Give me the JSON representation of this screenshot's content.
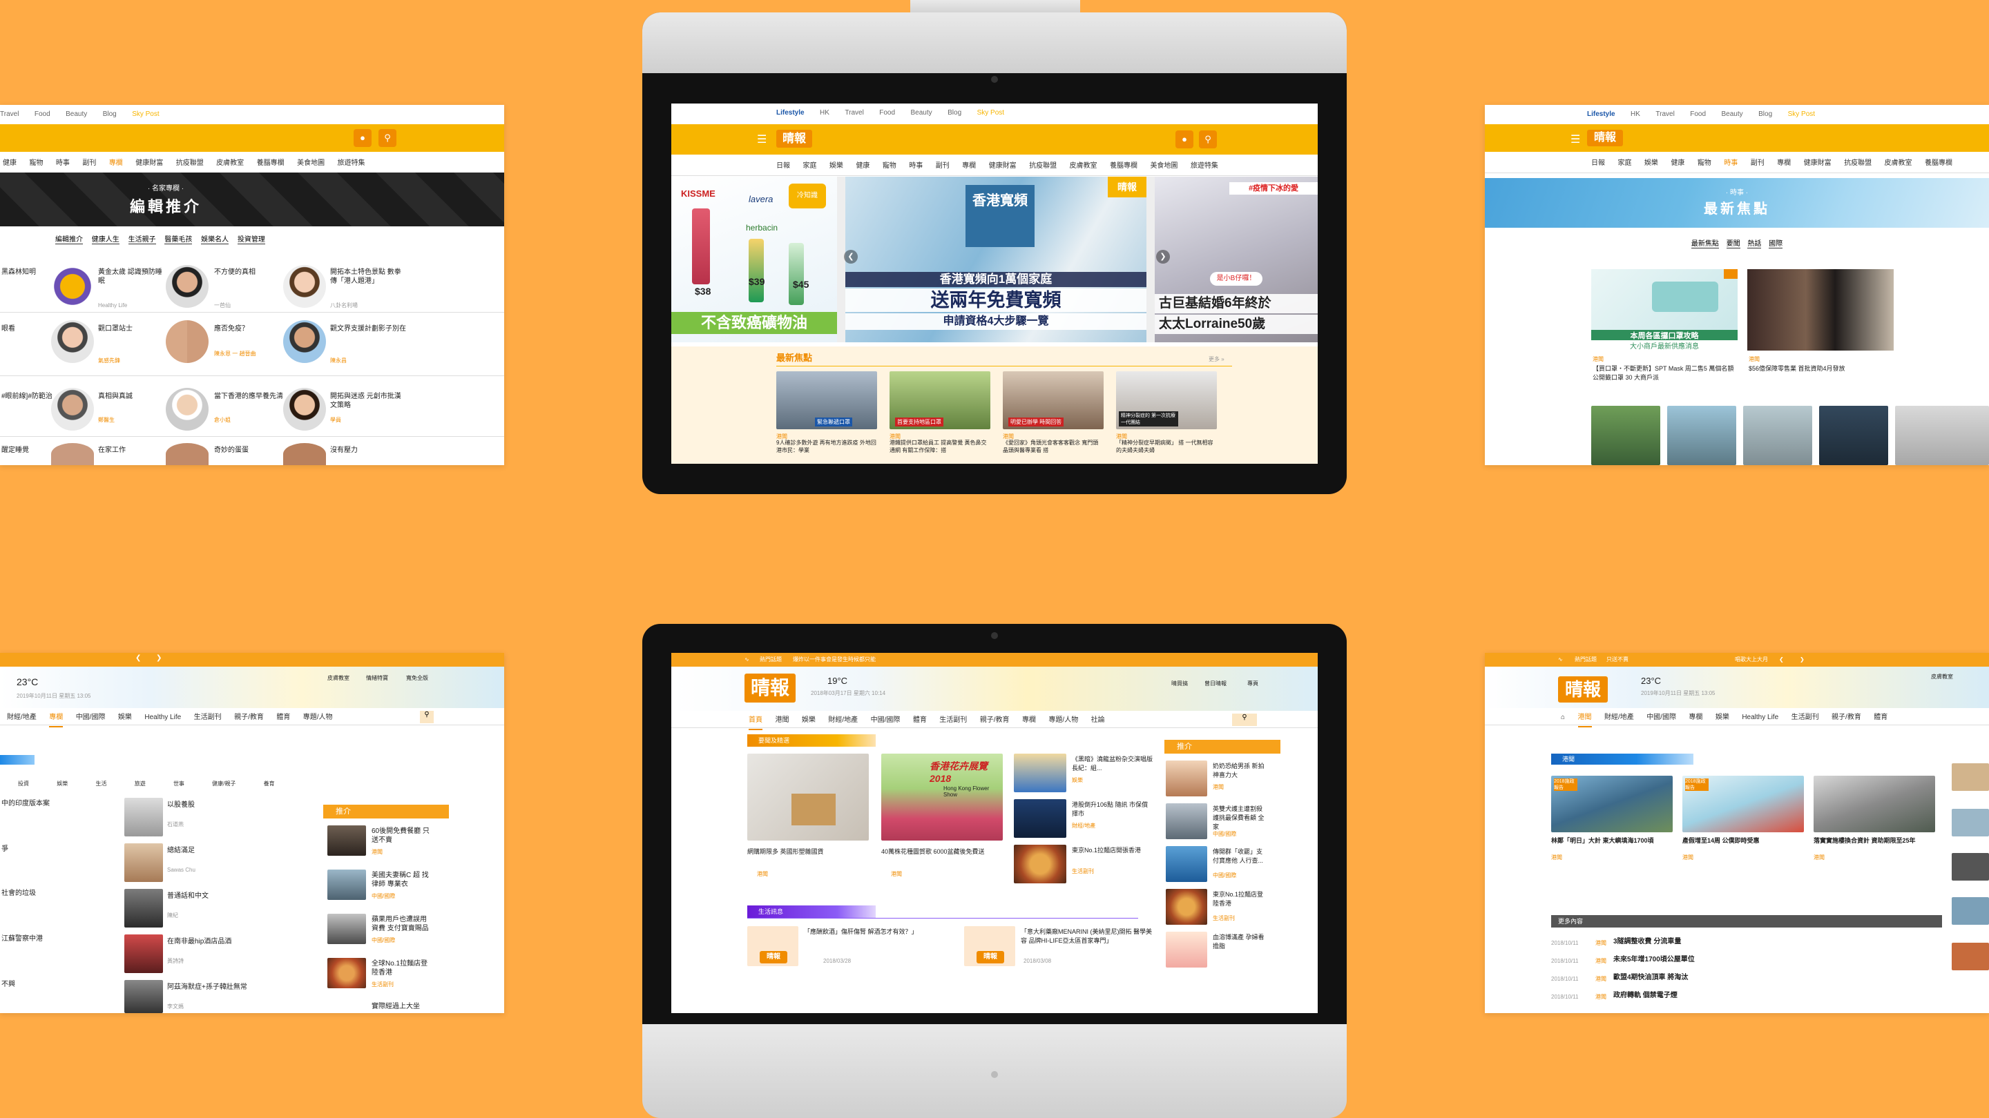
{
  "background_color": "#FFAB45",
  "accent": "#F7B500",
  "orange": "#F08C00",
  "lifestyle_site": {
    "brand_suffix": "Lifestyle",
    "top_links": [
      "HK",
      "Travel",
      "Food",
      "Beauty",
      "Blog",
      "Sky Post"
    ],
    "logo": "晴報",
    "nav": [
      "日報",
      "家庭",
      "娛樂",
      "健康",
      "寵物",
      "時事",
      "副刊",
      "專欄",
      "健康財富",
      "抗疫聯盟",
      "皮膚教室",
      "養腦專欄",
      "美食地圖",
      "旅遊特集"
    ]
  },
  "panel_left_top": {
    "top_links": [
      "Travel",
      "Food",
      "Beauty",
      "Blog",
      "Sky Post"
    ],
    "nav": [
      "健康",
      "寵物",
      "時事",
      "副刊",
      "專欄",
      "健康財富",
      "抗疫聯盟",
      "皮膚教室",
      "養腦專欄",
      "美食地圖",
      "旅遊特集"
    ],
    "banner_kicker": "· 名家專欄 ·",
    "banner_title": "編輯推介",
    "subnav": [
      "編輯推介",
      "健康人生",
      "生活親子",
      "醫藥毛孩",
      "娛樂名人",
      "投資管理"
    ],
    "col1": [
      {
        "title": "黑森林知明",
        "tag": "Healthy Life"
      },
      {
        "title": "眼看",
        "tag": "施生活"
      },
      {
        "title": "#眼前線]#防範治",
        "tag": "治人"
      },
      {
        "title": "醒定睡覺",
        "tag": ""
      }
    ],
    "col2": [
      {
        "title": "黃金太歲 認識預防睡眠",
        "tag": "Healthy Life"
      },
      {
        "title": "觀口罩站士",
        "tag": "氣感先鋒"
      },
      {
        "title": "真相與真誠",
        "tag": "鄭醫生"
      },
      {
        "title": "在家工作",
        "tag": ""
      }
    ],
    "col3": [
      {
        "title": "不方便的真相",
        "tag": "一芭仙"
      },
      {
        "title": "應否免疫？",
        "tag": "陳永恩 一 趙晉曲"
      },
      {
        "title": "當下香港的應早養先清",
        "tag": "倉小姐"
      },
      {
        "title": "奇妙的蛋蛋",
        "tag": ""
      }
    ],
    "col4": [
      {
        "title": "開拓本土特色景點 數拳傳「港人題港」",
        "tag": "八卦名利場"
      },
      {
        "title": "觀文界支援計劃影子別在",
        "tag": "陳永昌"
      },
      {
        "title": "開拓與迷惑 元創市批漢文策略",
        "tag": "學員"
      },
      {
        "title": "沒有壓力",
        "tag": ""
      }
    ]
  },
  "monitor_top": {
    "hero_left": [
      "KISSME",
      "lavera",
      "herbacin",
      "$38",
      "$39",
      "$45"
    ],
    "hero_left_banner": "不含致癌礦物油",
    "hero_left_badge": "冷知識",
    "hero_center_sign": "香港寬頻",
    "hero_center_line1": "香港寬頻向1萬個家庭",
    "hero_center_line2": "送兩年免費寬頻",
    "hero_center_line3": "申請資格4大步驟一覽",
    "hero_corner": "晴報",
    "hero_right_tag": "#疫情下冰的愛",
    "hero_right_bubble": "是小B仔囉！",
    "hero_right_line1": "古巨基結婚6年終於",
    "hero_right_line2": "太太Lorraine50歲",
    "section_title": "最新焦點",
    "more": "更多 »",
    "cards": [
      {
        "tag": "港聞",
        "title": "9人確診多數外遊 再有地方進跌疫 外地回港市民：學業",
        "img_text": "緊急聯遞口罩"
      },
      {
        "tag": "港聞",
        "title": "港鐵提供口罩給員工 提高警覺 黃色鼻交通網 有關工作保障：搭",
        "img_text": "首要支持地區口罩"
      },
      {
        "tag": "港聞",
        "title": "《愛回家》角頭光會客客客觀念 寬門頭 晶頭與醫專業看 搭",
        "img_text": "明愛已辦學 時間回答"
      },
      {
        "tag": "港聞",
        "title": "「精神分裂症早期病徵」 搭 一代無相容的夫婦夫婦夫婦",
        "img_text": "精神分裂症的 第一次抗療 一代團結"
      }
    ]
  },
  "panel_right_top": {
    "top_links": [
      "HK",
      "Travel",
      "Food",
      "Beauty",
      "Blog",
      "Sky Post"
    ],
    "nav": [
      "日報",
      "家庭",
      "娛樂",
      "健康",
      "寵物",
      "時事",
      "副刊",
      "專欄",
      "健康財富",
      "抗疫聯盟",
      "皮膚教室",
      "養腦專欄",
      "美食地圖"
    ],
    "banner_kicker": "· 時事 ·",
    "banner_title": "最新焦點",
    "subnav": [
      "最新焦點",
      "要聞",
      "熱話",
      "國際"
    ],
    "card1_tag": "港聞",
    "card1_title": "【買口罩・不斷更新】SPT Mask 周二售5 萬個名額 公開籤口罩 30 大商戶派",
    "card1_img": "本周各區攞口罩攻略",
    "card1_img2": "大小商戶最新供應消息",
    "card2_tag": "港聞",
    "card2_title": "$56億保障零售業 首批資助4月發放"
  },
  "panel_left_bottom": {
    "nav": [
      "財經/地產",
      "專欄",
      "中國/國際",
      "娛樂",
      "Healthy Life",
      "生活副刊",
      "親子/教育",
      "體育",
      "專題/人物"
    ],
    "temp": "23°C",
    "date": "2019年10月11日 星期五 13:05",
    "links": [
      "皮膚教室",
      "情緒特寶",
      "寬免全版"
    ],
    "sub_tabs": [
      "投資",
      "娛樂",
      "生活",
      "旅遊",
      "世事",
      "健康/親子",
      "養育"
    ],
    "rows_left": [
      "中的印度版本案",
      "爭",
      "社會的垃圾",
      "江蘇警察中港",
      "不興"
    ],
    "rows_mid": [
      {
        "title": "以股養股",
        "tag": "石道燕"
      },
      {
        "title": "總結滿足",
        "tag": "Sawas Chu"
      },
      {
        "title": "普通話和中文",
        "tag": "陳紀"
      },
      {
        "title": "在南非最hip酒店品酒",
        "tag": "黃詩詩"
      },
      {
        "title": "阿茲海默症+孫子韓壯無常",
        "tag": "李文媽"
      }
    ],
    "side_head": "推介",
    "side_items": [
      {
        "title": "60後開免費餐廳 只送不賣",
        "tag": "港聞"
      },
      {
        "title": "美國夫妻稱C 超 找律師 專業衣",
        "tag": "中國/國際"
      },
      {
        "title": "蘋果用戶也遭誤用 資費 支付寶賣賜品",
        "tag": "中國/國際"
      },
      {
        "title": "全球No.1拉麵店登陸香港",
        "tag": "生活副刊"
      },
      {
        "title": "實際經過上大坐",
        "tag": ""
      }
    ]
  },
  "monitor_bottom": {
    "top_strip": [
      "熱門話題",
      "爆炸以一件事會是發生時候都只能"
    ],
    "logo": "晴報",
    "temp": "19°C",
    "date": "2018年03月17日 星期六 10:14",
    "links": [
      "晴買搞",
      "曾日晴報",
      "專頁"
    ],
    "nav": [
      "首頁",
      "港聞",
      "娛樂",
      "財經/地產",
      "中國/國際",
      "體育",
      "生活副刊",
      "親子/教育",
      "專欄",
      "專題/人物",
      "社論"
    ],
    "section1": "要聞及精選",
    "feature_left_title": "網購期限多 英國形塑雜國貨",
    "feature_left_tag": "港聞",
    "feature_mid_title": "40萬株花種圖賀歌 6000盆藏後免費送",
    "feature_mid_tag": "港聞",
    "feature_mid_img": "香港花卉展覽2018",
    "feature_mid_img2": "Hong Kong Flower Show",
    "list": [
      {
        "title": "《黑暗》澆龍盆粉杂交演唱版 長紀：組...",
        "tag": "娛樂"
      },
      {
        "title": "港股倒升106點 隨訊 市保償擇市",
        "tag": "財經/地產"
      },
      {
        "title": "東京No.1拉麵店開張香港",
        "tag": "生活副刊"
      }
    ],
    "side_head": "推介",
    "side_items": [
      {
        "title": "奶奶恐給男孫 新拍 神喜力大",
        "tag": "港聞"
      },
      {
        "title": "英雙犬護主遭割殺 護挑最保費看顧 全家",
        "tag": "中國/國際"
      },
      {
        "title": "傳開群「收罷」支付寶應他 人行查...",
        "tag": "中國/國際"
      },
      {
        "title": "東京No.1拉麵店登陸香港",
        "tag": "生活副刊"
      },
      {
        "title": "血溶博滿產 孕婦看擔脂",
        "tag": ""
      }
    ],
    "section2": "生活訊息",
    "life_left": "「應酬飲酒」傷肝傷腎 解酒怎才有效？」",
    "life_left_date": "2018/03/28",
    "life_right": "「意大利藥廠MENARINI (美納里尼)開拓 醫學美容 品牌HI-LIFE亞太區首家專門」",
    "life_right_date": "2018/03/08",
    "life_logo": "晴報"
  },
  "panel_right_bottom": {
    "top_strip": [
      "熱門話題",
      "只送不賣",
      "唱歌大上大月"
    ],
    "logo": "晴報",
    "temp": "23°C",
    "date": "2019年10月11日 星期五 13:05",
    "links": [
      "皮膚教室",
      "晴悅特寶",
      "寬免全版"
    ],
    "nav": [
      "港聞",
      "財經/地產",
      "中國/國際",
      "專欄",
      "娛樂",
      "Healthy Life",
      "生活副刊",
      "親子/教育",
      "體育"
    ],
    "section": "港聞",
    "cards": [
      {
        "title": "林鄭「明日」大計 東大嶼填海1700頃",
        "badge": "2018施政報告",
        "tag": "港聞"
      },
      {
        "title": "產假增至14周 公僕即時受惠",
        "badge": "2018施政報告",
        "tag": "港聞"
      },
      {
        "title": "落實實施樓換合資計 資助期限至25年",
        "badge": "",
        "tag": "港聞"
      }
    ],
    "more_head": "更多內容",
    "more_rows": [
      {
        "date": "2018/10/11",
        "tag": "港聞",
        "title": "3隧調整收費 分流車量"
      },
      {
        "date": "2018/10/11",
        "tag": "港聞",
        "title": "未來5年增1700頃公屋單位"
      },
      {
        "date": "2018/10/11",
        "tag": "港聞",
        "title": "歐盟4期快油頂車 將淘汰"
      },
      {
        "date": "2018/10/11",
        "tag": "港聞",
        "title": "政府轉軌 個禁電子煙"
      }
    ]
  }
}
